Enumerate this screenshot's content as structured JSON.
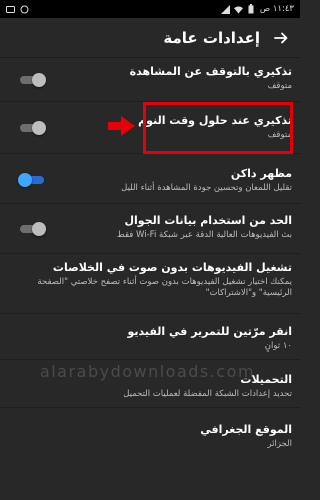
{
  "status_bar": {
    "time": "١١:٤٣ ص",
    "icons": [
      "signal-icon",
      "wifi-icon",
      "battery-icon",
      "message-icon",
      "notification-icon"
    ]
  },
  "app_bar": {
    "title": "إعدادات عامة",
    "back_icon": "arrow-right-icon"
  },
  "settings": [
    {
      "title": "تذكيري بالتوقف عن المشاهدة",
      "subtitle": "متوقف",
      "toggle": "off"
    },
    {
      "title": "تذكيري عند حلول وقت النوم",
      "subtitle": "متوقف",
      "toggle": "off"
    },
    {
      "title": "مظهر داكن",
      "subtitle": "تقليل اللمعان وتحسين جودة المشاهدة أثناء الليل",
      "toggle": "on"
    },
    {
      "title": "الحد من استخدام بيانات الجوال",
      "subtitle": "بث الفيديوهات العالية الدقة عبر شبكة Wi-Fi فقط",
      "toggle": "off"
    },
    {
      "title": "تشغيل الفيديوهات بدون صوت في الخلاصات",
      "subtitle": "يمكنك اختيار تشغيل الفيديوهات بدون صوت أثناء تصفح خلاصتي \"الصفحة الرئيسية\" و\"الاشتراكات\"",
      "toggle": null
    },
    {
      "title": "انقر مرّتين للتمرير في الفيديو",
      "subtitle": "١٠ ثوانٍ",
      "toggle": null
    },
    {
      "title": "التحميلات",
      "subtitle": "تحديد إعدادات الشبكة المفضلة لعمليات التحميل",
      "toggle": null
    },
    {
      "title": "الموقع الجغرافي",
      "subtitle": "الجزائر",
      "toggle": null
    }
  ],
  "watermark": "alarabydownloads.com",
  "colors": {
    "background": "#282828",
    "toggle_on": "#3ea6ff",
    "highlight": "#e5000a"
  }
}
